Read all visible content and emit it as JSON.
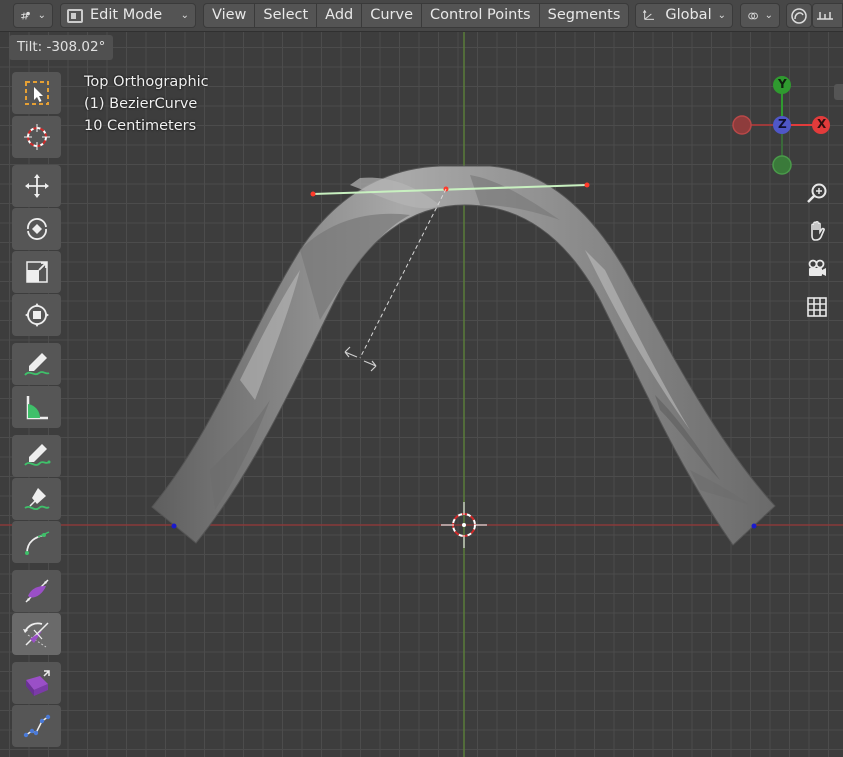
{
  "header": {
    "mode_label": "Edit Mode",
    "menus": [
      "View",
      "Select",
      "Add",
      "Curve",
      "Control Points",
      "Segments"
    ],
    "transform_orientation": "Global"
  },
  "status": {
    "tilt": "Tilt: -308.02°"
  },
  "viewport_info": {
    "view_name": "Top Orthographic",
    "object_name": "(1) BezierCurve",
    "scale": "10 Centimeters"
  },
  "gizmo": {
    "y_label": "Y",
    "z_label": "Z",
    "x_label": "X"
  },
  "toolbar": {
    "tools": [
      "select-box-icon",
      "cursor-icon",
      "move-icon",
      "rotate-icon",
      "scale-icon",
      "transform-icon",
      "annotate-icon",
      "measure-icon",
      "draw-icon",
      "pen-icon",
      "curve-pen-icon",
      "radius-icon",
      "tilt-icon",
      "extrude-icon",
      "randomize-icon"
    ],
    "active_tool": "tilt-icon"
  },
  "colors": {
    "x_axis": "#e23b3b",
    "y_axis": "#2f9a2f",
    "z_axis": "#4f57c7",
    "background": "#3d3d3d",
    "curve_mesh": "#9a9a9a"
  }
}
